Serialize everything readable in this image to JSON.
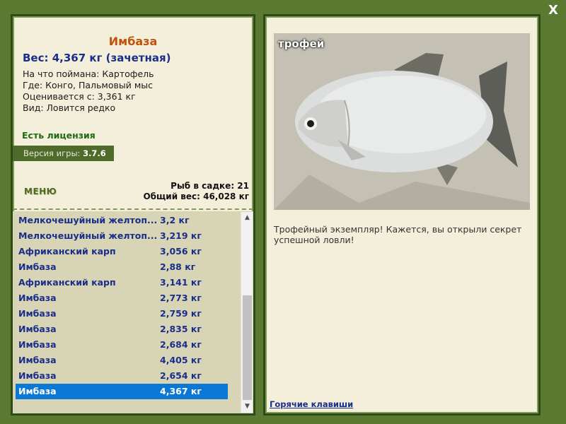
{
  "window": {
    "close_label": "X"
  },
  "fish": {
    "name": "Имбаза",
    "weight_line": "Вес: 4,367 кг (зачетная)",
    "details": [
      "На что поймана: Картофель",
      "Где: Конго, Пальмовый мыс",
      "Оценивается с: 3,361 кг",
      "Вид: Ловится редко"
    ]
  },
  "license": "Есть лицензия",
  "version": {
    "label": "Версия игры:",
    "value": "3.7.6"
  },
  "menu_label": "МЕНЮ",
  "keep": {
    "count_line": "Рыб в садке: 21",
    "total_line": "Общий вес: 46,028 кг"
  },
  "catch_list": [
    {
      "name": "Мелкочешуйный желтоп...",
      "weight": "3,2 кг"
    },
    {
      "name": "Мелкочешуйный желтоп...",
      "weight": "3,219 кг"
    },
    {
      "name": "Африканский карп",
      "weight": "3,056 кг"
    },
    {
      "name": "Имбаза",
      "weight": "2,88 кг"
    },
    {
      "name": "Африканский карп",
      "weight": "3,141 кг"
    },
    {
      "name": "Имбаза",
      "weight": "2,773 кг"
    },
    {
      "name": "Имбаза",
      "weight": "2,759 кг"
    },
    {
      "name": "Имбаза",
      "weight": "2,835 кг"
    },
    {
      "name": "Имбаза",
      "weight": "2,684 кг"
    },
    {
      "name": "Имбаза",
      "weight": "4,405 кг"
    },
    {
      "name": "Имбаза",
      "weight": "2,654 кг"
    },
    {
      "name": "Имбаза",
      "weight": "4,367 кг",
      "selected": true
    }
  ],
  "photo": {
    "badge": "трофей"
  },
  "description": "Трофейный экземпляр! Кажется, вы открыли секрет успешной ловли!",
  "hotkeys_label": "Горячие клавиши",
  "icons": {
    "close": "close-icon",
    "scroll_up": "chevron-up-icon",
    "scroll_down": "chevron-down-icon"
  },
  "colors": {
    "background": "#5a7a32",
    "panel": "#f3efdb",
    "fish_name": "#c0520a",
    "text_blue": "#1b2d8a",
    "license_green": "#1f6b13",
    "selection": "#0c78d6"
  }
}
